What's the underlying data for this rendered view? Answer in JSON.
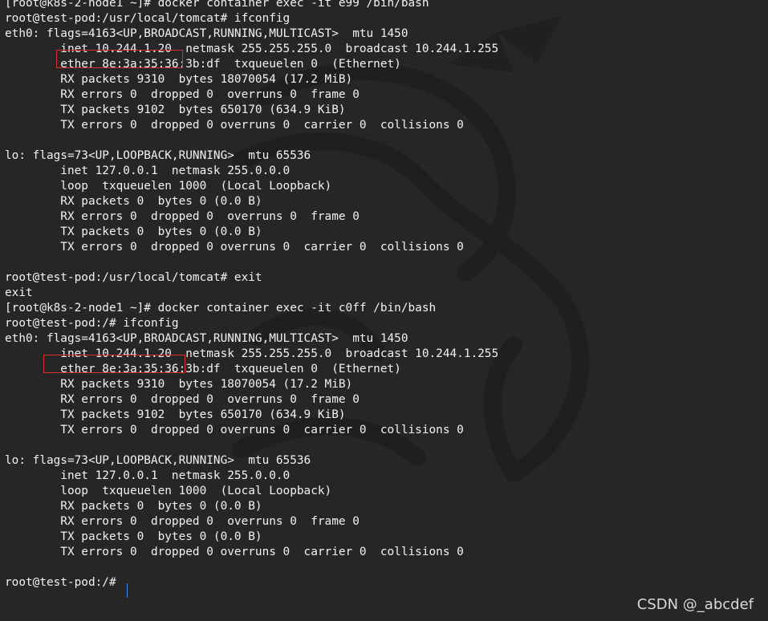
{
  "colors": {
    "background": "#262626",
    "text": "#f2f2f2",
    "highlight_box": "#d9302c",
    "cursor": "#3a8ee6"
  },
  "terminal": {
    "lines": [
      "[root@k8s-2-node1 ~]# docker container exec -it e99 /bin/bash",
      "root@test-pod:/usr/local/tomcat# ifconfig",
      "eth0: flags=4163<UP,BROADCAST,RUNNING,MULTICAST>  mtu 1450",
      "        inet 10.244.1.20  netmask 255.255.255.0  broadcast 10.244.1.255",
      "        ether 8e:3a:35:36:3b:df  txqueuelen 0  (Ethernet)",
      "        RX packets 9310  bytes 18070054 (17.2 MiB)",
      "        RX errors 0  dropped 0  overruns 0  frame 0",
      "        TX packets 9102  bytes 650170 (634.9 KiB)",
      "        TX errors 0  dropped 0 overruns 0  carrier 0  collisions 0",
      "",
      "lo: flags=73<UP,LOOPBACK,RUNNING>  mtu 65536",
      "        inet 127.0.0.1  netmask 255.0.0.0",
      "        loop  txqueuelen 1000  (Local Loopback)",
      "        RX packets 0  bytes 0 (0.0 B)",
      "        RX errors 0  dropped 0  overruns 0  frame 0",
      "        TX packets 0  bytes 0 (0.0 B)",
      "        TX errors 0  dropped 0 overruns 0  carrier 0  collisions 0",
      "",
      "root@test-pod:/usr/local/tomcat# exit",
      "exit",
      "[root@k8s-2-node1 ~]# docker container exec -it c0ff /bin/bash",
      "root@test-pod:/# ifconfig",
      "eth0: flags=4163<UP,BROADCAST,RUNNING,MULTICAST>  mtu 1450",
      "        inet 10.244.1.20  netmask 255.255.255.0  broadcast 10.244.1.255",
      "        ether 8e:3a:35:36:3b:df  txqueuelen 0  (Ethernet)",
      "        RX packets 9310  bytes 18070054 (17.2 MiB)",
      "        RX errors 0  dropped 0  overruns 0  frame 0",
      "        TX packets 9102  bytes 650170 (634.9 KiB)",
      "        TX errors 0  dropped 0 overruns 0  carrier 0  collisions 0",
      "",
      "lo: flags=73<UP,LOOPBACK,RUNNING>  mtu 65536",
      "        inet 127.0.0.1  netmask 255.0.0.0",
      "        loop  txqueuelen 1000  (Local Loopback)",
      "        RX packets 0  bytes 0 (0.0 B)",
      "        RX errors 0  dropped 0  overruns 0  frame 0",
      "        TX packets 0  bytes 0 (0.0 B)",
      "        TX errors 0  dropped 0 overruns 0  carrier 0  collisions 0",
      "",
      "root@test-pod:/# "
    ]
  },
  "watermark": {
    "text": "CSDN @_abcdef",
    "logo_icon": "dragon-logo-icon"
  }
}
